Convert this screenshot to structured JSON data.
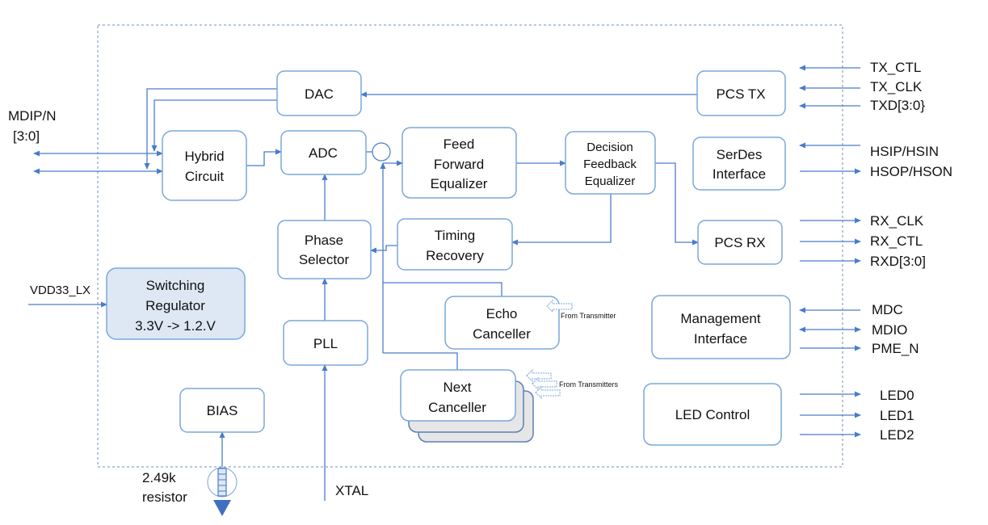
{
  "colors": {
    "line": "#4a7cc9",
    "box_border": "#7aa7dc",
    "regulator_fill": "#dde8f4",
    "canceller_shadow": "#e6e6e6"
  },
  "blocks": {
    "dac": "DAC",
    "hybrid": [
      "Hybrid",
      "Circuit"
    ],
    "adc": "ADC",
    "ffe": [
      "Feed",
      "Forward",
      "Equalizer"
    ],
    "dfe": [
      "Decision",
      "Feedback",
      "Equalizer"
    ],
    "pcs_tx": "PCS TX",
    "serdes": [
      "SerDes",
      "Interface"
    ],
    "pcs_rx": "PCS RX",
    "timing": [
      "Timing",
      "Recovery"
    ],
    "phase": [
      "Phase",
      "Selector"
    ],
    "regulator": [
      "Switching",
      "Regulator",
      "3.3V -> 1.2.V"
    ],
    "pll": "PLL",
    "echo": [
      "Echo",
      "Canceller"
    ],
    "next": [
      "Next",
      "Canceller"
    ],
    "mgmt": [
      "Management",
      "Interface"
    ],
    "led": "LED Control",
    "bias": "BIAS"
  },
  "annotations": {
    "from_transmitter": "From Transmitter",
    "from_transmitters": "From Transmitters"
  },
  "signals": {
    "mdip": [
      "MDIP/N",
      "[3:0]"
    ],
    "vdd": "VDD33_LX",
    "resistor": [
      "2.49k",
      "resistor"
    ],
    "xtal": "XTAL",
    "tx": [
      "TX_CTL",
      "TX_CLK",
      "TXD[3:0}"
    ],
    "hs": [
      "HSIP/HSIN",
      "HSOP/HSON"
    ],
    "rx": [
      "RX_CLK",
      "RX_CTL",
      "RXD[3:0]"
    ],
    "mgmt": [
      "MDC",
      "MDIO",
      "PME_N"
    ],
    "led": [
      "LED0",
      "LED1",
      "LED2"
    ]
  }
}
